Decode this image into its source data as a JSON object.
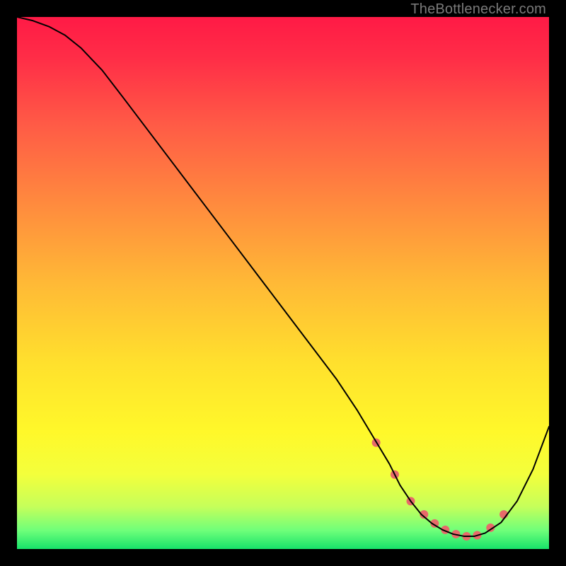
{
  "attribution": "TheBottlenecker.com",
  "chart_data": {
    "type": "line",
    "title": "",
    "xlabel": "",
    "ylabel": "",
    "xlim": [
      0,
      100
    ],
    "ylim": [
      0,
      100
    ],
    "grid": false,
    "background_gradient": {
      "stops": [
        {
          "offset": 0.0,
          "color": "#ff1a46"
        },
        {
          "offset": 0.08,
          "color": "#ff2e47"
        },
        {
          "offset": 0.2,
          "color": "#ff5a46"
        },
        {
          "offset": 0.35,
          "color": "#ff8a3e"
        },
        {
          "offset": 0.5,
          "color": "#ffb936"
        },
        {
          "offset": 0.65,
          "color": "#ffe02d"
        },
        {
          "offset": 0.78,
          "color": "#fff82a"
        },
        {
          "offset": 0.86,
          "color": "#f3ff3c"
        },
        {
          "offset": 0.92,
          "color": "#c6ff5a"
        },
        {
          "offset": 0.965,
          "color": "#6fff7a"
        },
        {
          "offset": 1.0,
          "color": "#17e36a"
        }
      ]
    },
    "series": [
      {
        "name": "curve",
        "stroke": "#000000",
        "stroke_width": 2,
        "x": [
          0,
          3,
          6,
          9,
          12,
          16,
          20,
          25,
          30,
          35,
          40,
          45,
          50,
          55,
          60,
          64,
          67,
          70,
          72,
          74,
          76,
          78,
          80,
          82,
          84,
          86,
          88,
          91,
          94,
          97,
          100
        ],
        "y": [
          100,
          99.3,
          98.2,
          96.6,
          94.2,
          90.0,
          84.8,
          78.2,
          71.6,
          65.0,
          58.4,
          51.8,
          45.2,
          38.6,
          32.0,
          26.0,
          21.0,
          16.0,
          12.0,
          9.0,
          6.5,
          4.8,
          3.6,
          2.8,
          2.4,
          2.4,
          3.0,
          5.0,
          9.0,
          15.0,
          23.0
        ]
      }
    ],
    "markers": {
      "name": "threshold-band",
      "color": "#e76a6a",
      "radius": 6,
      "x": [
        67.5,
        71,
        74,
        76.5,
        78.5,
        80.5,
        82.5,
        84.5,
        86.5,
        89,
        91.5
      ],
      "y": [
        20.0,
        14.0,
        9.0,
        6.5,
        4.8,
        3.6,
        2.8,
        2.4,
        2.6,
        4.0,
        6.5
      ]
    }
  }
}
